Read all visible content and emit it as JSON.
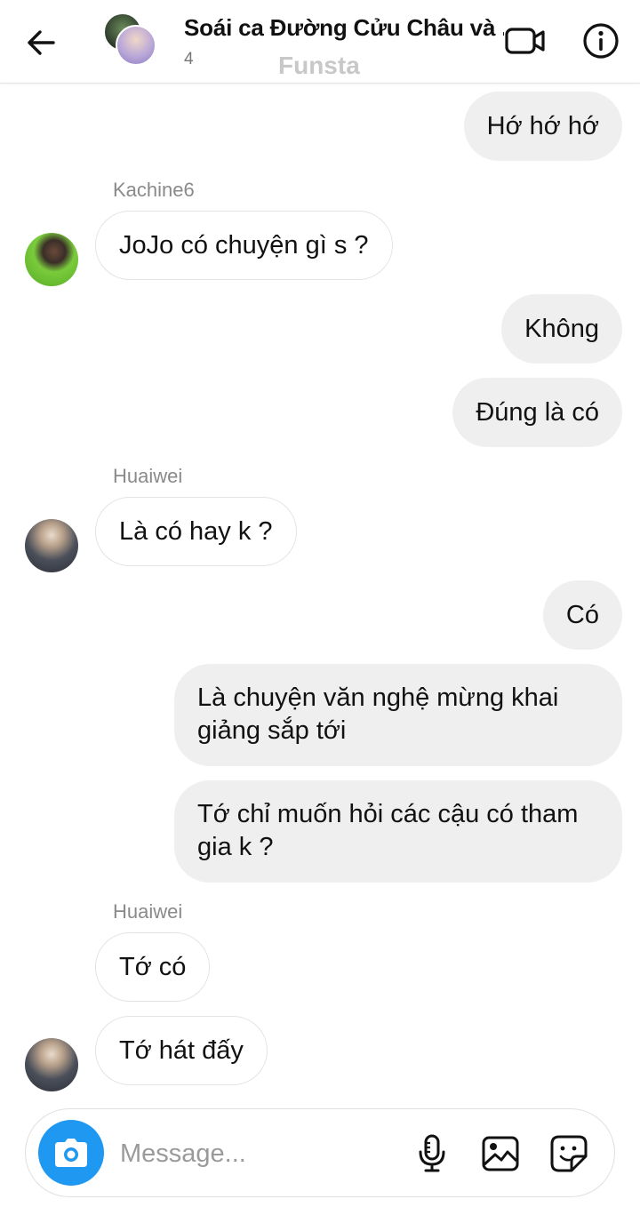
{
  "header": {
    "title": "Soái ca Đường Cửu Châu và ...",
    "member_count": "4",
    "watermark": "Funsta",
    "icons": {
      "back": "arrow-left-icon",
      "video": "video-camera-icon",
      "info": "info-circle-icon"
    }
  },
  "messages": [
    {
      "dir": "out",
      "text": "Hớ hớ hớ"
    },
    {
      "dir": "label",
      "sender": "Kachine6"
    },
    {
      "dir": "in",
      "text": "JoJo có chuyện gì s ?"
    },
    {
      "dir": "out",
      "text": "Không"
    },
    {
      "dir": "out",
      "text": "Đúng là có"
    },
    {
      "dir": "label",
      "sender": "Huaiwei"
    },
    {
      "dir": "in",
      "text": "Là có hay k ?"
    },
    {
      "dir": "out",
      "text": "Có"
    },
    {
      "dir": "out",
      "text": "Là chuyện văn nghệ mừng khai giảng sắp tới"
    },
    {
      "dir": "out",
      "text": "Tớ chỉ muốn hỏi các cậu có tham gia k ?"
    },
    {
      "dir": "label",
      "sender": "Huaiwei"
    },
    {
      "dir": "in",
      "text": "Tớ có"
    },
    {
      "dir": "in",
      "text": "Tớ hát đấy"
    }
  ],
  "composer": {
    "placeholder": "Message...",
    "icons": {
      "camera": "camera-icon",
      "mic": "microphone-icon",
      "gallery": "image-icon",
      "sticker": "sticker-icon"
    }
  },
  "colors": {
    "accent": "#1e98f0",
    "outgoing_bubble": "#efefef",
    "incoming_border": "#e3e3e3"
  }
}
